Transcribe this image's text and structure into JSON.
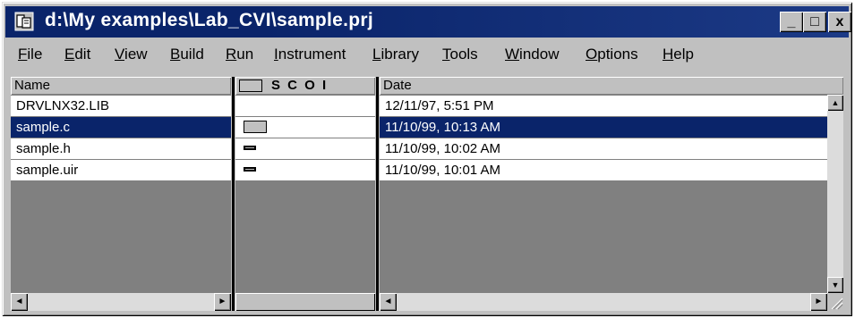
{
  "window": {
    "title": "d:\\My examples\\Lab_CVI\\sample.prj",
    "min_label": "_",
    "max_label": "□",
    "close_label": "x"
  },
  "menu": [
    {
      "accel": "F",
      "rest": "ile"
    },
    {
      "accel": "E",
      "rest": "dit"
    },
    {
      "accel": "V",
      "rest": "iew"
    },
    {
      "accel": "B",
      "rest": "uild"
    },
    {
      "accel": "R",
      "rest": "un"
    },
    {
      "accel": "I",
      "rest": "nstrument"
    },
    {
      "accel": "L",
      "rest": "ibrary"
    },
    {
      "accel": "T",
      "rest": "ools"
    },
    {
      "accel": "W",
      "rest": "indow"
    },
    {
      "accel": "O",
      "rest": "ptions"
    },
    {
      "accel": "H",
      "rest": "elp"
    }
  ],
  "columns": {
    "name": "Name",
    "status": "S  C  O  I",
    "date": "Date"
  },
  "files": [
    {
      "name": "DRVLNX32.LIB",
      "date": "12/11/97, 5:51 PM",
      "selected": false,
      "mark": "none"
    },
    {
      "name": "sample.c",
      "date": "11/10/99, 10:13 AM",
      "selected": true,
      "mark": "block"
    },
    {
      "name": "sample.h",
      "date": "11/10/99, 10:02 AM",
      "selected": false,
      "mark": "dash"
    },
    {
      "name": "sample.uir",
      "date": "11/10/99, 10:01 AM",
      "selected": false,
      "mark": "dash"
    }
  ],
  "scroll": {
    "left_arrow": "◄",
    "right_arrow": "►",
    "up_arrow": "▲",
    "down_arrow": "▼"
  }
}
